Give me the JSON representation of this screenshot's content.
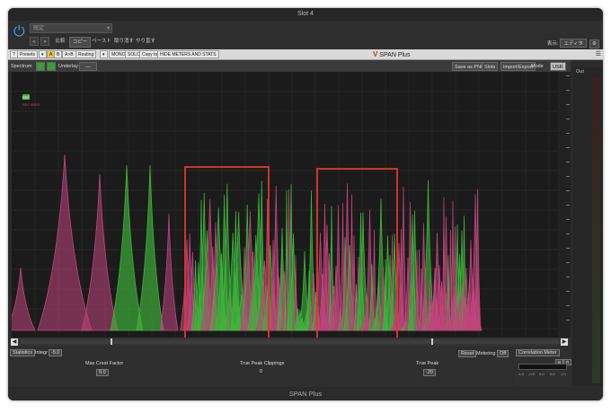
{
  "window": {
    "title": "Slot 4"
  },
  "host": {
    "preset_value": "既定",
    "back_label": "<",
    "forward_label": ">",
    "compare_label": "比較",
    "copy_label": "コピー",
    "paste_label": "ペースト",
    "undo_label": "取り消す",
    "redo_label": "やり直す",
    "view_label": "表示:",
    "view_value": "エディタ"
  },
  "plugin_toolbar": {
    "presets_label": "Presets",
    "a_label": "A",
    "b_label": "B",
    "ab_label": "A>B",
    "routing_label": "Routing",
    "mono_label": "MONO",
    "solo_label": "SOLO",
    "copy_to_label": "Copy to",
    "meters_label": "HIDE METERS AND STATS",
    "logo_text": "SPAN Plus"
  },
  "spectrum_bar": {
    "spectrum_label": "Spectrum",
    "underlay_label": "Underlay",
    "underlay_value": "—",
    "save_png_label": "Save as PNG",
    "slots_label": "Slots",
    "import_export_label": "Import/Export",
    "mode_label": "Mode",
    "mode_value": "USR"
  },
  "legend": {
    "series_1": "REF",
    "series_2": "REF MIRR"
  },
  "out_label": "Out",
  "statistics": {
    "title": "Statistics",
    "integr_label": "Integr",
    "integr_value": "-5.0",
    "max_crest_factor_label": "Max Crest Factor",
    "max_crest_factor_value": "0.0",
    "true_peak_clippings_label": "True Peak Clippings",
    "true_peak_clippings_value": "0",
    "true_peak_label": "True Peak",
    "true_peak_value": "-20",
    "reset_label": "Reset",
    "metering_label": "Metering",
    "metering_value": "Off"
  },
  "correlation": {
    "title": "Correlation Meter",
    "btn1": "B",
    "btn2": "R",
    "ticks": [
      "-1.0",
      "-0.5",
      "0.0",
      "0.5",
      "1.0"
    ]
  },
  "footer": {
    "title": "SPAN Plus"
  },
  "colors": {
    "green_series": "#3fb53c",
    "pink_series": "#c0457c",
    "highlight_box": "#e0392c",
    "panel_bg": "#2b2b2b"
  }
}
